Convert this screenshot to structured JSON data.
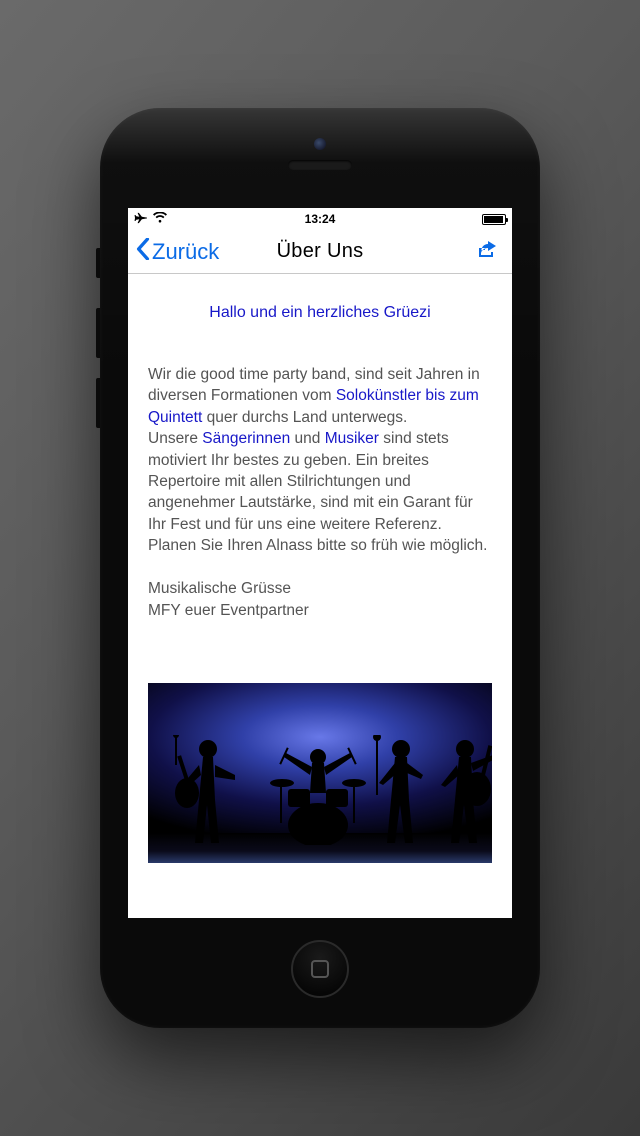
{
  "status": {
    "time": "13:24"
  },
  "nav": {
    "back": "Zurück",
    "title": "Über Uns"
  },
  "greeting": "Hallo und ein herzliches Grüezi",
  "body": {
    "p1a": "Wir die good time party band, sind seit Jahren in diversen Formationen vom ",
    "link1": "Solokünstler bis zum Quintett",
    "p1b": " quer durchs Land unterwegs.",
    "p2a": "Unsere ",
    "link2": "Sängerinnen",
    "p2b": " und ",
    "link3": "Musiker",
    "p2c": " sind stets motiviert Ihr bestes zu geben. Ein breites Repertoire mit allen Stilrichtungen und angenehmer Lautstärke, sind mit ein Garant für Ihr Fest und für uns eine weitere Referenz.",
    "p3": "Planen Sie Ihren Alnass bitte so früh wie möglich.",
    "sig1": "Musikalische Grüsse",
    "sig2": "MFY euer Eventpartner"
  }
}
